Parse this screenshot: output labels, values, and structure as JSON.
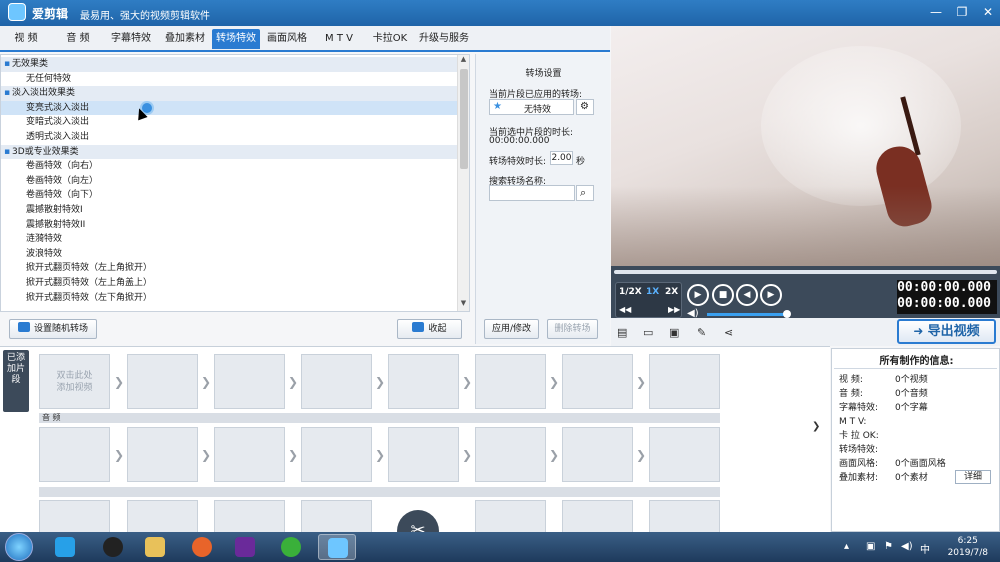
{
  "app": {
    "name": "爱剪辑",
    "slogan": "最易用、强大的视频剪辑软件"
  },
  "tabs": [
    "视 频",
    "音 频",
    "字幕特效",
    "叠加素材",
    "转场特效",
    "画面风格",
    "M T V",
    "卡拉OK",
    "升级与服务"
  ],
  "active_tab": "转场特效",
  "effects": [
    {
      "type": "cat",
      "label": "无效果类"
    },
    {
      "type": "item",
      "label": "无任何特效"
    },
    {
      "type": "cat",
      "label": "淡入淡出效果类"
    },
    {
      "type": "item",
      "label": "变亮式淡入淡出",
      "selected": true
    },
    {
      "type": "item",
      "label": "变暗式淡入淡出"
    },
    {
      "type": "item",
      "label": "透明式淡入淡出"
    },
    {
      "type": "cat",
      "label": "3D或专业效果类"
    },
    {
      "type": "item",
      "label": "卷画特效（向右）"
    },
    {
      "type": "item",
      "label": "卷画特效（向左）"
    },
    {
      "type": "item",
      "label": "卷画特效（向下）"
    },
    {
      "type": "item",
      "label": "震撼散射特效I"
    },
    {
      "type": "item",
      "label": "震撼散射特效II"
    },
    {
      "type": "item",
      "label": "涟漪特效"
    },
    {
      "type": "item",
      "label": "波浪特效"
    },
    {
      "type": "item",
      "label": "掀开式翻页特效（左上角掀开）"
    },
    {
      "type": "item",
      "label": "掀开式翻页特效（左上角盖上）"
    },
    {
      "type": "item",
      "label": "掀开式翻页特效（左下角掀开）"
    }
  ],
  "buttons": {
    "random": "设置随机转场",
    "favorite": "收起",
    "apply": "应用/修改",
    "delete": "删除转场",
    "export": "导出视频",
    "detail": "详细"
  },
  "settings": {
    "title": "转场设置",
    "applied_label": "当前片段已应用的转场:",
    "applied_value": "无特效",
    "duration_label": "当前选中片段的时长:",
    "duration_value": "00:00:00.000",
    "effect_len_label": "转场特效时长:",
    "effect_len_value": "2.00",
    "effect_len_unit": "秒",
    "search_label": "搜索转场名称:",
    "search_value": ""
  },
  "player": {
    "speeds": [
      "1/2X",
      "1X",
      "2X"
    ],
    "time_current": "00:00:00.000",
    "time_total": "00:00:00.000"
  },
  "timeline": {
    "side_label": "已添加片段",
    "add_hint": "双击此处\n添加视频",
    "audio_label": "音 频"
  },
  "info": {
    "title": "所有制作的信息:",
    "rows": [
      {
        "k": "视    频:",
        "v": "0个视频"
      },
      {
        "k": "音    频:",
        "v": "0个音频"
      },
      {
        "k": "字幕特效:",
        "v": "0个字幕"
      },
      {
        "k": "M  T  V:",
        "v": ""
      },
      {
        "k": "卡 拉 OK:",
        "v": ""
      },
      {
        "k": "转场特效:",
        "v": ""
      },
      {
        "k": "画面风格:",
        "v": "0个画面风格"
      },
      {
        "k": "叠加素材:",
        "v": "0个素材"
      }
    ]
  },
  "taskbar": {
    "time": "6:25",
    "date": "2019/7/8"
  },
  "colors": {
    "accent": "#2a7bd1",
    "titlebar": "#1f64a8",
    "player": "#3c4a5a"
  }
}
